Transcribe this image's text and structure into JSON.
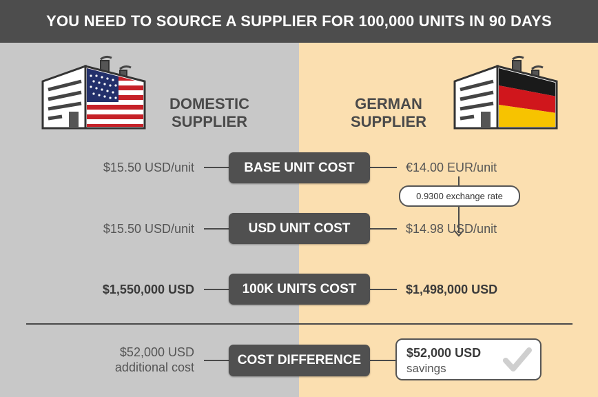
{
  "title": "YOU NEED TO SOURCE A SUPPLIER FOR 100,000 UNITS IN 90 DAYS",
  "domestic": {
    "title_line1": "DOMESTIC",
    "title_line2": "SUPPLIER",
    "flag_icon": "us-flag-factory-icon",
    "base_unit_cost": "$15.50 USD/unit",
    "usd_unit_cost": "$15.50 USD/unit",
    "units_cost": "$1,550,000 USD",
    "difference_amount": "$52,000 USD",
    "difference_label": "additional cost"
  },
  "german": {
    "title_line1": "GERMAN",
    "title_line2": "SUPPLIER",
    "flag_icon": "german-flag-factory-icon",
    "base_unit_cost": "€14.00 EUR/unit",
    "exchange_rate": "0.9300 exchange rate",
    "usd_unit_cost": "$14.98 USD/unit",
    "units_cost": "$1,498,000 USD",
    "difference_amount": "$52,000 USD",
    "difference_label": "savings"
  },
  "rows": {
    "base": "BASE UNIT COST",
    "usd": "USD UNIT COST",
    "total": "100K UNITS COST",
    "difference": "COST DIFFERENCE"
  },
  "colors": {
    "header": "#4d4d4d",
    "domestic_bg": "#c8c8c8",
    "german_bg": "#fbdfb0",
    "pill": "#505050"
  }
}
